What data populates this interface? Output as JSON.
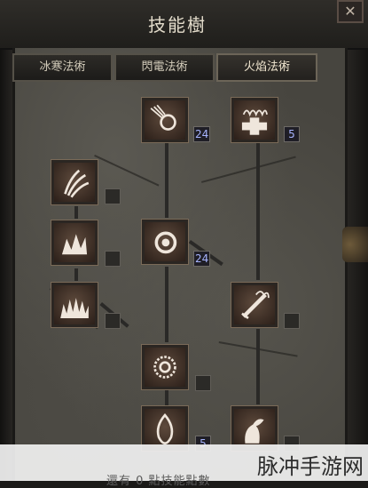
{
  "window": {
    "title": "技能樹",
    "close_glyph": "✕"
  },
  "tabs": [
    {
      "label": "冰寒法術",
      "active": false
    },
    {
      "label": "閃電法術",
      "active": false
    },
    {
      "label": "火焰法術",
      "active": true
    }
  ],
  "skills": [
    {
      "icon": "fire-bolt-icon",
      "level": "24"
    },
    {
      "icon": "warmth-icon",
      "level": "5"
    },
    {
      "icon": "inferno-icon",
      "level": ""
    },
    {
      "icon": "blaze-icon",
      "level": ""
    },
    {
      "icon": "fire-ball-icon",
      "level": "24"
    },
    {
      "icon": "fire-wall-icon",
      "level": ""
    },
    {
      "icon": "enchant-icon",
      "level": ""
    },
    {
      "icon": "meteor-icon",
      "level": ""
    },
    {
      "icon": "fire-mastery-icon",
      "level": "5"
    },
    {
      "icon": "hydra-icon",
      "level": ""
    }
  ],
  "footer": {
    "text": "還有 0 點技能點數"
  },
  "watermark": "脉冲手游网"
}
